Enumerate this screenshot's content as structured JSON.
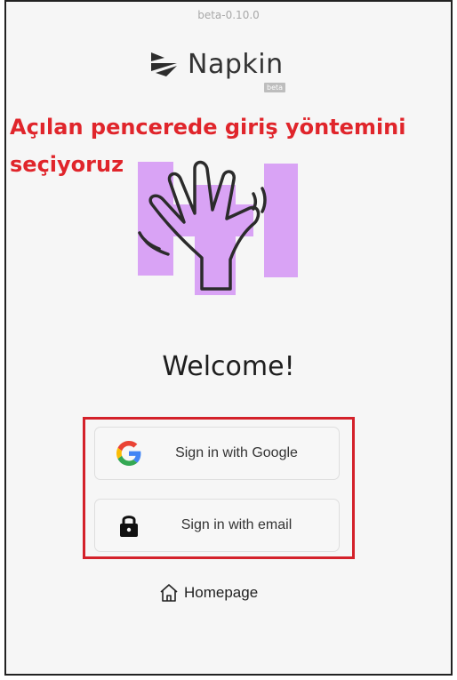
{
  "header": {
    "version": "beta-0.10.0"
  },
  "logo": {
    "name": "Napkin",
    "badge": "beta"
  },
  "annotation": {
    "text": "Açılan pencerede giriş yöntemini seçiyoruz"
  },
  "welcome": {
    "title": "Welcome!"
  },
  "auth": {
    "google_label": "Sign in with Google",
    "email_label": "Sign in with email"
  },
  "footer": {
    "homepage_label": "Homepage"
  },
  "colors": {
    "annotation": "#e0252b",
    "highlight_border": "#d4212a",
    "hero_purple": "#d9a3f5"
  },
  "icons": [
    "napkin-logo-icon",
    "waving-hand-icon",
    "google-icon",
    "lock-icon",
    "home-icon"
  ]
}
